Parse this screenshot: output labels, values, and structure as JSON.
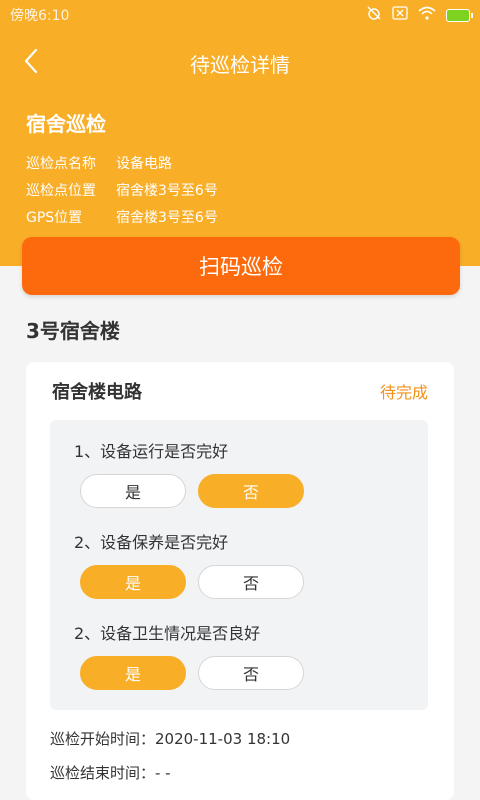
{
  "status_bar": {
    "time": "傍晚6:10",
    "icons": [
      "alarm-off-icon",
      "sim-icon",
      "wifi-icon",
      "battery-charging-icon"
    ]
  },
  "nav": {
    "title": "待巡检详情",
    "back_icon": "chevron-left-icon"
  },
  "task": {
    "title": "宿舍巡检",
    "rows": [
      {
        "key": "巡检点名称",
        "value": "设备电路"
      },
      {
        "key": "巡检点位置",
        "value": "宿舍楼3号至6号"
      },
      {
        "key": "GPS位置",
        "value": "宿舍楼3号至6号"
      }
    ]
  },
  "scan_button": {
    "label": "扫码巡检"
  },
  "building": {
    "title": "3号宿舍楼"
  },
  "card": {
    "title": "宿舍楼电路",
    "status": "待完成",
    "questions": [
      {
        "text": "1、设备运行是否完好",
        "yes": "是",
        "no": "否",
        "selected": "no"
      },
      {
        "text": "2、设备保养是否完好",
        "yes": "是",
        "no": "否",
        "selected": "yes"
      },
      {
        "text": "2、设备卫生情况是否良好",
        "yes": "是",
        "no": "否",
        "selected": "yes"
      }
    ],
    "start_time": "巡检开始时间：2020-11-03 18:10",
    "end_time": "巡检结束时间：- -"
  },
  "colors": {
    "header": "#f9ae28",
    "scan_button": "#fc6a0d",
    "status": "#f0921b",
    "pill_on": "#f9ae28"
  }
}
